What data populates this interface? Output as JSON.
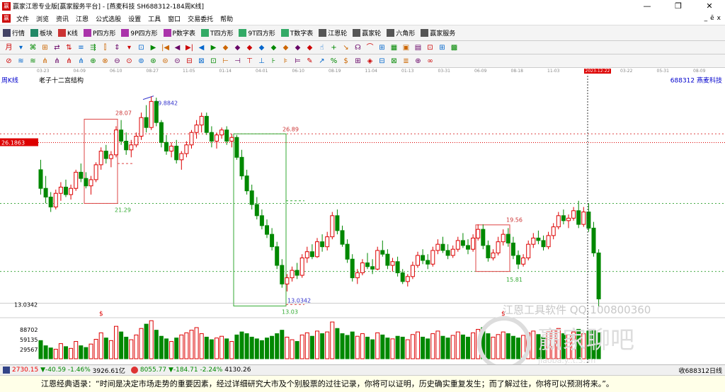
{
  "window": {
    "title": "赢家江恩专业版[赢家服务平台] - [燕麦科技  SH688312-184周K线]",
    "app_icon": "赢",
    "controls": [
      "—",
      "❐",
      "✕"
    ]
  },
  "menu": {
    "items": [
      "文件",
      "浏览",
      "资讯",
      "江恩",
      "公式选股",
      "设置",
      "工具",
      "窗口",
      "交易委托",
      "帮助"
    ],
    "right": [
      "_",
      "ē",
      "x"
    ]
  },
  "toolbar": {
    "items": [
      {
        "label": "行情",
        "icon": "grid-icon",
        "color": "#446"
      },
      {
        "label": "板块",
        "icon": "blocks-icon",
        "color": "#286"
      },
      {
        "label": "K线",
        "icon": "candles-icon",
        "color": "#c33"
      },
      {
        "label": "P四方形",
        "icon": "p-square-icon",
        "color": "#a3a"
      },
      {
        "label": "9P四方形",
        "icon": "9p-square-icon",
        "color": "#a3a"
      },
      {
        "label": "P数字表",
        "icon": "p-table-icon",
        "color": "#a3a"
      },
      {
        "label": "T四方形",
        "icon": "t-square-icon",
        "color": "#3a6"
      },
      {
        "label": "9T四方形",
        "icon": "9t-square-icon",
        "color": "#3a6"
      },
      {
        "label": "T数字表",
        "icon": "t-table-icon",
        "color": "#3a6"
      },
      {
        "label": "江恩轮",
        "icon": "wheel-icon",
        "color": "#555"
      },
      {
        "label": "赢家轮",
        "icon": "winner-wheel-icon",
        "color": "#555"
      },
      {
        "label": "六角形",
        "icon": "hexagon-icon",
        "color": "#555"
      },
      {
        "label": "赢家服务",
        "icon": "service-icon",
        "color": "#555"
      }
    ]
  },
  "tools_row1": [
    "月",
    "▾",
    "⌘",
    "⊞",
    "⇄",
    "⇅",
    "≡",
    "⇶",
    "⫿",
    "⇕",
    "▾",
    "⊡",
    "▶",
    "|◀",
    "◀",
    "▶|",
    "◀",
    "▶",
    "◆",
    "◆",
    "◆",
    "◆",
    "◆",
    "◆",
    "◆",
    "◆",
    "☝",
    "+",
    "↘",
    "☊",
    "⌒",
    "⊞",
    "▦",
    "▣",
    "▤",
    "⊡",
    "⊞",
    "▩"
  ],
  "tools_row2": [
    "⊘",
    "≋",
    "≋",
    "⋔",
    "⋔",
    "⋔",
    "⋔",
    "⊕",
    "⊗",
    "⊖",
    "⊙",
    "⊚",
    "⊛",
    "⊜",
    "⊝",
    "⊟",
    "⊠",
    "⊡",
    "⊢",
    "⊣",
    "⊤",
    "⊥",
    "⊦",
    "⊧",
    "⊨",
    "✎",
    "↗",
    "%",
    "$",
    "⊞",
    "◈",
    "⊟",
    "⊠",
    "≣",
    "⊕",
    "∞"
  ],
  "dates": [
    "03-23",
    "04-09",
    "06-10",
    "08-27",
    "11-05",
    "01-14",
    "04-01",
    "06-10",
    "08-19",
    "11-04",
    "01-13",
    "03-31",
    "06-09",
    "08-18",
    "11-03",
    "2023-12-22",
    "03-22",
    "05-31",
    "08-09"
  ],
  "chart_labels": {
    "period": "周K线",
    "indicator": "老子十二宫结构",
    "stock": "688312  燕麦科技",
    "current_price": "26.1863",
    "price_low_label": "13.0342",
    "watermark1": "江恩工具软件  QQ:100800360",
    "watermark2": "赢家聊吧",
    "watermark3": "jiaoba.y..t.3..m"
  },
  "chart_data": {
    "type": "candlestick",
    "annotations": [
      {
        "label": "29.8842",
        "color": "#33c"
      },
      {
        "label": "28.07",
        "color": "#c33"
      },
      {
        "label": "21.29",
        "color": "#3a3"
      },
      {
        "label": "26.89",
        "color": "#c33"
      },
      {
        "label": "13.0342",
        "color": "#33c"
      },
      {
        "label": "13.03",
        "color": "#3a3"
      },
      {
        "label": "19.56",
        "color": "#c33"
      },
      {
        "label": "15.81",
        "color": "#3a3"
      }
    ],
    "dividend_marks": [
      "$",
      "$"
    ],
    "volume_ticks": [
      "88702",
      "59135",
      "29567"
    ],
    "ohlc": [
      [
        24.0,
        24.8,
        22.0,
        22.5
      ],
      [
        22.5,
        23.5,
        21.3,
        21.8
      ],
      [
        21.8,
        22.2,
        20.6,
        21.0
      ],
      [
        21.0,
        22.4,
        20.8,
        22.1
      ],
      [
        22.1,
        23.0,
        21.5,
        22.6
      ],
      [
        22.6,
        23.2,
        21.8,
        22.0
      ],
      [
        22.0,
        22.8,
        21.6,
        22.5
      ],
      [
        22.5,
        24.0,
        22.3,
        23.8
      ],
      [
        23.8,
        24.5,
        23.0,
        23.3
      ],
      [
        23.3,
        23.8,
        22.5,
        22.7
      ],
      [
        22.7,
        23.5,
        22.0,
        23.2
      ],
      [
        23.2,
        24.6,
        23.0,
        24.4
      ],
      [
        24.4,
        25.8,
        24.0,
        25.5
      ],
      [
        25.5,
        26.0,
        24.5,
        24.9
      ],
      [
        24.9,
        25.5,
        24.2,
        25.2
      ],
      [
        25.2,
        27.5,
        25.0,
        27.2
      ],
      [
        27.2,
        28.0,
        26.0,
        26.3
      ],
      [
        26.3,
        27.0,
        25.2,
        25.6
      ],
      [
        25.6,
        26.4,
        25.0,
        26.0
      ],
      [
        26.0,
        27.0,
        25.8,
        26.7
      ],
      [
        26.7,
        28.6,
        26.4,
        28.2
      ],
      [
        28.2,
        29.2,
        27.0,
        27.4
      ],
      [
        27.4,
        29.9,
        27.2,
        29.5
      ],
      [
        29.5,
        29.8,
        27.5,
        27.8
      ],
      [
        27.8,
        28.0,
        25.8,
        26.2
      ],
      [
        26.2,
        26.8,
        25.2,
        25.5
      ],
      [
        25.5,
        26.2,
        25.0,
        25.9
      ],
      [
        25.9,
        26.4,
        24.5,
        24.8
      ],
      [
        24.8,
        25.5,
        24.0,
        25.3
      ],
      [
        25.3,
        26.3,
        25.0,
        26.0
      ],
      [
        26.0,
        27.2,
        25.7,
        27.0
      ],
      [
        27.0,
        28.0,
        26.5,
        27.6
      ],
      [
        27.6,
        28.6,
        27.0,
        28.3
      ],
      [
        28.3,
        28.6,
        26.8,
        27.0
      ],
      [
        27.0,
        27.5,
        25.8,
        26.3
      ],
      [
        26.3,
        27.0,
        25.7,
        26.8
      ],
      [
        26.8,
        27.4,
        26.5,
        27.2
      ],
      [
        27.2,
        27.5,
        26.0,
        26.3
      ],
      [
        26.3,
        26.9,
        25.8,
        26.6
      ],
      [
        26.6,
        26.8,
        24.8,
        25.0
      ],
      [
        25.0,
        25.6,
        23.2,
        23.5
      ],
      [
        23.5,
        24.0,
        22.0,
        22.3
      ],
      [
        22.3,
        22.8,
        20.8,
        21.2
      ],
      [
        21.2,
        21.8,
        20.0,
        20.3
      ],
      [
        20.3,
        20.8,
        19.2,
        19.5
      ],
      [
        19.5,
        20.0,
        18.5,
        18.8
      ],
      [
        18.8,
        19.3,
        17.5,
        17.8
      ],
      [
        17.8,
        18.2,
        16.0,
        16.3
      ],
      [
        16.3,
        16.8,
        14.5,
        14.8
      ],
      [
        14.8,
        15.6,
        14.2,
        15.3
      ],
      [
        15.3,
        16.2,
        15.0,
        15.9
      ],
      [
        15.9,
        16.5,
        15.2,
        15.5
      ],
      [
        15.5,
        17.2,
        15.3,
        16.9
      ],
      [
        16.9,
        17.8,
        16.5,
        17.4
      ],
      [
        17.4,
        18.0,
        16.8,
        17.0
      ],
      [
        17.0,
        18.5,
        16.9,
        18.2
      ],
      [
        18.2,
        18.8,
        17.4,
        17.8
      ],
      [
        17.8,
        19.0,
        17.5,
        18.6
      ],
      [
        18.6,
        20.6,
        18.4,
        20.3
      ],
      [
        20.3,
        20.8,
        18.8,
        19.1
      ],
      [
        19.1,
        19.5,
        17.8,
        18.0
      ],
      [
        18.0,
        18.4,
        16.5,
        16.8
      ],
      [
        16.8,
        17.2,
        15.0,
        15.3
      ],
      [
        15.3,
        16.0,
        14.8,
        15.7
      ],
      [
        15.7,
        16.8,
        15.5,
        16.5
      ],
      [
        16.5,
        17.3,
        16.0,
        16.2
      ],
      [
        16.2,
        16.8,
        15.6,
        16.0
      ],
      [
        16.0,
        17.8,
        15.9,
        17.5
      ],
      [
        17.5,
        18.3,
        17.0,
        17.2
      ],
      [
        17.2,
        17.6,
        16.0,
        16.3
      ],
      [
        16.3,
        16.9,
        15.8,
        16.6
      ],
      [
        16.6,
        17.0,
        15.4,
        15.7
      ],
      [
        15.7,
        16.0,
        14.8,
        15.0
      ],
      [
        15.0,
        15.6,
        14.6,
        15.4
      ],
      [
        15.4,
        16.6,
        15.2,
        16.3
      ],
      [
        16.3,
        17.4,
        16.1,
        17.1
      ],
      [
        17.1,
        17.6,
        16.4,
        16.7
      ],
      [
        16.7,
        17.2,
        16.0,
        16.4
      ],
      [
        16.4,
        17.8,
        16.2,
        17.5
      ],
      [
        17.5,
        18.4,
        17.2,
        18.0
      ],
      [
        18.0,
        18.6,
        17.3,
        17.5
      ],
      [
        17.5,
        18.0,
        16.8,
        17.1
      ],
      [
        17.1,
        17.9,
        16.9,
        17.6
      ],
      [
        17.6,
        18.6,
        17.4,
        18.3
      ],
      [
        18.3,
        18.9,
        17.7,
        17.9
      ],
      [
        17.9,
        18.4,
        17.2,
        17.6
      ],
      [
        17.6,
        18.8,
        17.4,
        18.5
      ],
      [
        18.5,
        19.6,
        18.3,
        19.2
      ],
      [
        19.2,
        19.6,
        17.6,
        17.9
      ],
      [
        17.9,
        18.3,
        16.6,
        16.9
      ],
      [
        16.9,
        17.6,
        16.7,
        17.3
      ],
      [
        17.3,
        18.6,
        17.1,
        18.2
      ],
      [
        18.2,
        19.2,
        17.9,
        18.8
      ],
      [
        18.8,
        19.3,
        17.8,
        18.1
      ],
      [
        18.1,
        18.6,
        16.8,
        17.1
      ],
      [
        17.1,
        17.5,
        16.0,
        16.4
      ],
      [
        16.4,
        17.2,
        16.2,
        16.9
      ],
      [
        16.9,
        18.3,
        16.7,
        18.0
      ],
      [
        18.0,
        18.9,
        17.7,
        18.5
      ],
      [
        18.5,
        19.1,
        18.0,
        18.3
      ],
      [
        18.3,
        18.7,
        17.5,
        17.8
      ],
      [
        17.8,
        19.0,
        17.6,
        18.7
      ],
      [
        18.7,
        19.7,
        18.4,
        19.4
      ],
      [
        19.4,
        20.6,
        19.2,
        20.3
      ],
      [
        20.3,
        20.8,
        19.6,
        19.9
      ],
      [
        19.9,
        20.4,
        19.3,
        20.1
      ],
      [
        20.1,
        21.0,
        19.9,
        20.7
      ],
      [
        20.7,
        21.5,
        19.3,
        19.6
      ],
      [
        19.6,
        21.0,
        19.4,
        20.6
      ],
      [
        20.6,
        21.3,
        19.0,
        19.3
      ],
      [
        19.3,
        19.8,
        17.0,
        17.3
      ],
      [
        17.3,
        17.6,
        13.0,
        13.6
      ]
    ],
    "volumes": [
      42,
      30,
      25,
      22,
      35,
      28,
      24,
      40,
      30,
      26,
      34,
      45,
      60,
      48,
      42,
      75,
      62,
      50,
      44,
      55,
      70,
      80,
      88,
      66,
      52,
      46,
      40,
      48,
      55,
      60,
      66,
      72,
      58,
      50,
      44,
      48,
      52,
      46,
      40,
      55,
      62,
      58,
      50,
      46,
      42,
      48,
      52,
      58,
      66,
      50,
      44,
      40,
      55,
      60,
      52,
      64,
      58,
      62,
      85,
      70,
      58,
      54,
      62,
      52,
      58,
      50,
      44,
      60,
      55,
      48,
      46,
      52,
      50,
      44,
      56,
      62,
      50,
      46,
      58,
      64,
      52,
      48,
      54,
      62,
      55,
      50,
      60,
      68,
      72,
      58,
      50,
      56,
      62,
      58,
      52,
      48,
      54,
      60,
      64,
      56,
      50,
      62,
      66,
      70,
      58,
      55,
      62,
      68,
      58,
      64,
      66,
      60
    ]
  },
  "status": {
    "index1": {
      "icon": "grid-icon",
      "value": "2730.15",
      "change": "▼-40.59",
      "pct": "-1.46%",
      "vol": "3926.61亿"
    },
    "index2": {
      "icon": "sz-icon",
      "value": "8055.77",
      "change": "▼-184.71",
      "pct": "-2.24%",
      "vol": "4130.26"
    },
    "right": "收688312日线"
  },
  "quote": "江恩经典语录：“时间是决定市场走势的重要因素，经过详细研究大市及个别股票的过往记录，你将可以证明，历史确实重复发生；而了解过往，你将可以预测将来。”。"
}
